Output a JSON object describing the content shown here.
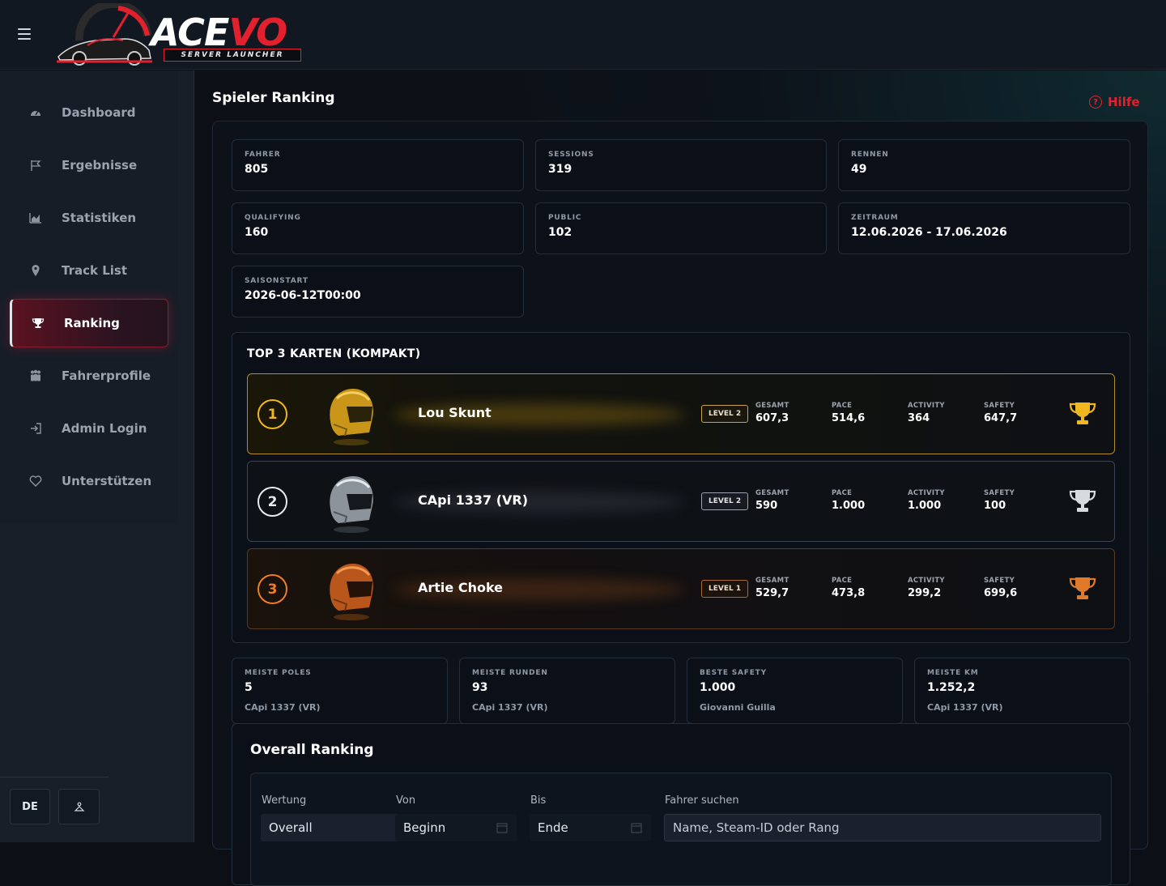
{
  "app": {
    "logo_main": "ACE",
    "logo_accent": "VO",
    "logo_sub": "SERVER LAUNCHER"
  },
  "sidebar": {
    "items": [
      {
        "label": "Dashboard",
        "icon": "gauge-icon"
      },
      {
        "label": "Ergebnisse",
        "icon": "flag-icon"
      },
      {
        "label": "Statistiken",
        "icon": "chart-icon"
      },
      {
        "label": "Track List",
        "icon": "map-pin-icon"
      },
      {
        "label": "Ranking",
        "icon": "trophy-icon",
        "active": true
      },
      {
        "label": "Fahrerprofile",
        "icon": "users-icon"
      },
      {
        "label": "Admin Login",
        "icon": "login-icon"
      },
      {
        "label": "Unterstützen",
        "icon": "heart-icon"
      }
    ],
    "language": "DE"
  },
  "page": {
    "title": "Spieler Ranking",
    "help": "Hilfe"
  },
  "stats": [
    {
      "label": "FAHRER",
      "value": "805"
    },
    {
      "label": "SESSIONS",
      "value": "319"
    },
    {
      "label": "RENNEN",
      "value": "49"
    },
    {
      "label": "QUALIFYING",
      "value": "160"
    },
    {
      "label": "PUBLIC",
      "value": "102"
    },
    {
      "label": "ZEITRAUM",
      "value": "12.06.2026 - 17.06.2026"
    },
    {
      "label": "SAISONSTART",
      "value": "2026-06-12T00:00"
    }
  ],
  "top3": {
    "title": "TOP 3 KARTEN (KOMPAKT)",
    "metric_labels": [
      "GESAMT",
      "PACE",
      "ACTIVITY",
      "SAFETY"
    ],
    "cards": [
      {
        "rank": "1",
        "name": "Lou Skunt",
        "level": "LEVEL 2",
        "values": [
          "607,3",
          "514,6",
          "364",
          "647,7"
        ],
        "color": "#f0b81e"
      },
      {
        "rank": "2",
        "name": "CApi 1337 (VR)",
        "level": "LEVEL 2",
        "values": [
          "590",
          "1.000",
          "1.000",
          "100"
        ],
        "color": "#e8ecf0"
      },
      {
        "rank": "3",
        "name": "Artie Choke",
        "level": "LEVEL 1",
        "values": [
          "529,7",
          "473,8",
          "299,2",
          "699,6"
        ],
        "color": "#ef7d2a"
      }
    ]
  },
  "records": [
    {
      "label": "MEISTE POLES",
      "value": "5",
      "driver": "CApi 1337 (VR)"
    },
    {
      "label": "MEISTE RUNDEN",
      "value": "93",
      "driver": "CApi 1337 (VR)"
    },
    {
      "label": "BESTE SAFETY",
      "value": "1.000",
      "driver": "Giovanni Guilla"
    },
    {
      "label": "MEISTE KM",
      "value": "1.252,2",
      "driver": "CApi 1337 (VR)"
    }
  ],
  "overall": {
    "title": "Overall Ranking",
    "filters": {
      "wertung_label": "Wertung",
      "wertung_value": "Overall",
      "von_label": "Von",
      "von_value": "Beginn",
      "bis_label": "Bis",
      "bis_value": "Ende",
      "search_label": "Fahrer suchen",
      "search_placeholder": "Name, Steam-ID oder Rang"
    }
  }
}
